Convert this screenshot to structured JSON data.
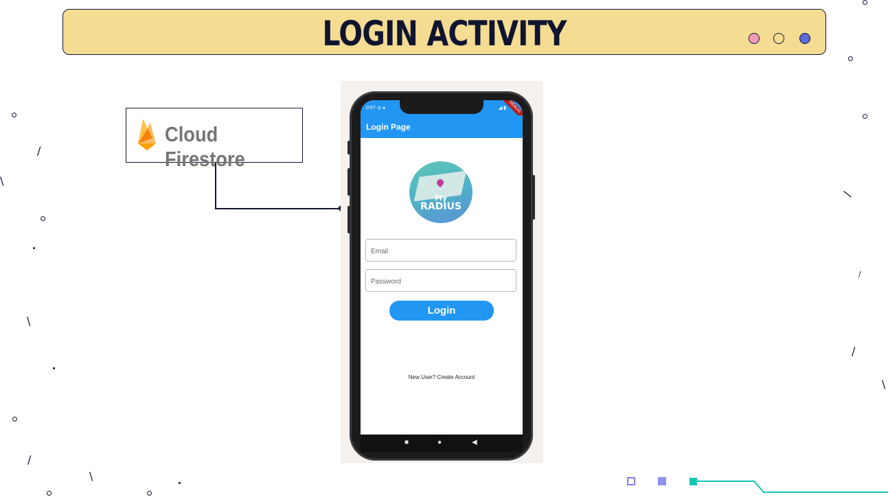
{
  "header": {
    "title": "LOGIN ACTIVITY"
  },
  "window_dots": {
    "colors": [
      "#f39ab8",
      "#f4dc93",
      "#5d6ad8"
    ]
  },
  "callout": {
    "label": "Cloud Firestore",
    "icon": "firebase-flame-icon"
  },
  "phone": {
    "status_time": "0:57",
    "debug_banner": "DEBUG",
    "appbar_title": "Login Page",
    "logo": {
      "line1": "My",
      "line2": "RADIUS"
    },
    "email_placeholder": "Email",
    "password_placeholder": "Password",
    "login_label": "Login",
    "create_account_text": "New User? Create Account",
    "nav": {
      "square": "■",
      "circle": "●",
      "back": "◀"
    }
  },
  "colors": {
    "accent_blue": "#2196f3",
    "title_bg": "#f4dc93",
    "navy": "#0f1530",
    "teal": "#12c6b4"
  }
}
